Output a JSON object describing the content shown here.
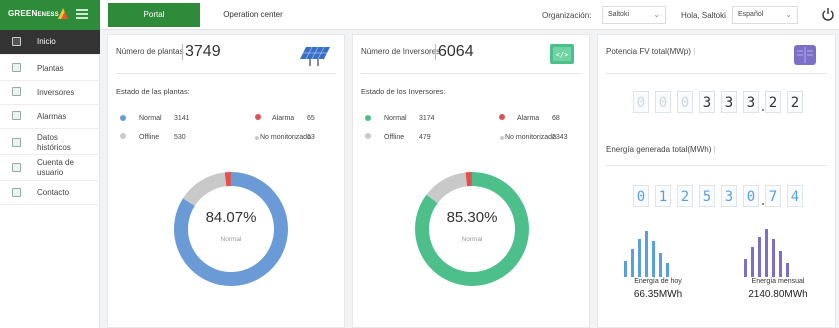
{
  "brand": {
    "name": "GREEN",
    "name_suffix": "ENESS"
  },
  "topbar": {
    "tab_portal": "Portal",
    "tab_operation": "Operation center",
    "org_label": "Organización:",
    "org_value": "Saltoki",
    "greeting": "Hola, Saltoki",
    "language": "Español"
  },
  "sidebar": {
    "items": [
      {
        "label": "Inicio"
      },
      {
        "label": "Plantas"
      },
      {
        "label": "Inversores"
      },
      {
        "label": "Alarmas"
      },
      {
        "label": "Datos históricos"
      },
      {
        "label": "Cuenta de usuario"
      },
      {
        "label": "Contacto"
      }
    ]
  },
  "plants": {
    "title": "Número de plantas",
    "count": "3749",
    "status_title": "Estado de las plantas:",
    "normal_label": "Normal",
    "normal_value": "3141",
    "alarm_label": "Alarma",
    "alarm_value": "65",
    "offline_label": "Offline",
    "offline_value": "530",
    "nomon_label": "No monitorizado",
    "nomon_value": "13",
    "donut_pct": "84.07%",
    "donut_sub": "Normal",
    "ring_color": "#6b9bd6"
  },
  "inverters": {
    "title": "Número de Inversores",
    "count": "6064",
    "status_title": "Estado de los Inversores:",
    "normal_label": "Normal",
    "normal_value": "3174",
    "alarm_label": "Alarma",
    "alarm_value": "68",
    "offline_label": "Offline",
    "offline_value": "479",
    "nomon_label": "No monitorizado",
    "nomon_value": "2343",
    "donut_pct": "85.30%",
    "donut_sub": "Normal",
    "ring_color": "#4cbf8b"
  },
  "power": {
    "title": "Potencia FV total(MWp)",
    "digits": [
      "0",
      "0",
      "0",
      "3",
      "3",
      "3",
      "2",
      "2"
    ],
    "energy_title": "Energía generada total(MWh)",
    "energy_digits": [
      "0",
      "1",
      "2",
      "5",
      "3",
      "0",
      "7",
      "4"
    ],
    "today_label": "Energía de hoy",
    "today_value": "66.35MWh",
    "monthly_label": "Energía mensual",
    "monthly_value": "2140.80MWh"
  },
  "colors": {
    "accent_green": "#2e8b3a",
    "normal_blue": "#6b9bd6",
    "normal_green": "#4cbf8b",
    "alarm_red": "#e05252",
    "offline_gray": "#c9c9c9",
    "bars_blue": "#5aa0dd",
    "bars_purple": "#7b6fc6"
  },
  "icons": {
    "menu": "hamburger-icon",
    "power": "power-icon",
    "plants_card": "solar-panel-icon",
    "inverters_card": "inverter-icon",
    "power_card": "book-icon"
  }
}
